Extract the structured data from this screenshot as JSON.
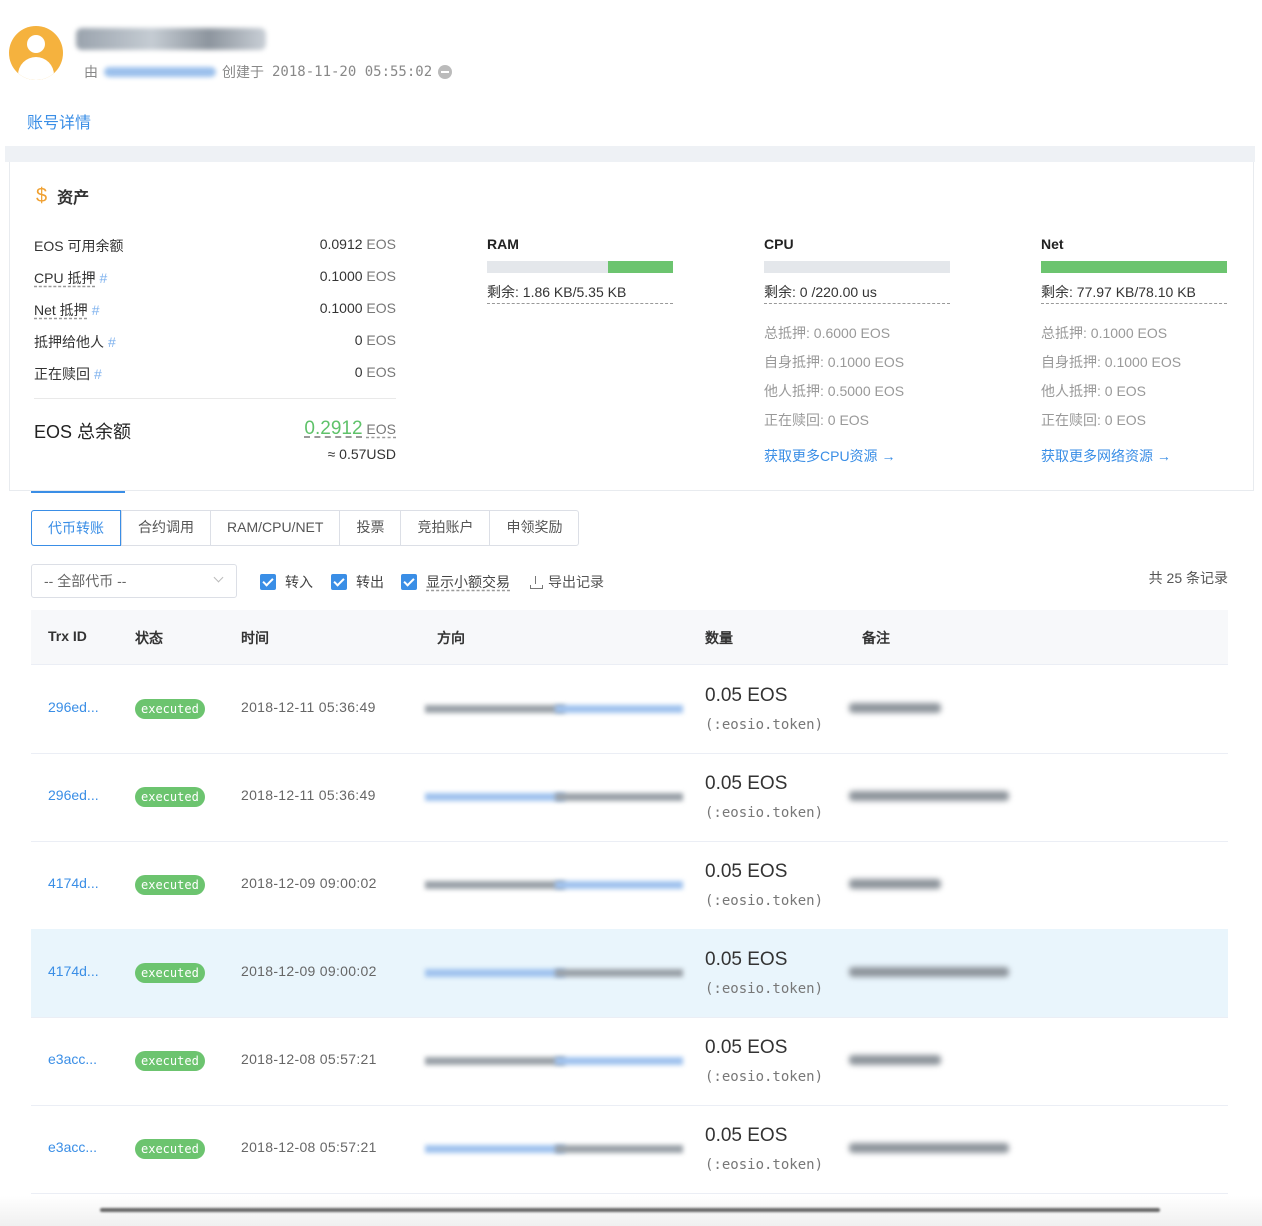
{
  "header": {
    "by_label": "由",
    "created_label": "创建于",
    "created_time": "2018-11-20 05:55:02"
  },
  "main_tab": "账号详情",
  "assets": {
    "title": "资产",
    "rows": [
      {
        "label": "EOS 可用余额",
        "value": "0.0912",
        "unit": "EOS",
        "hash": ""
      },
      {
        "label": "CPU 抵押",
        "value": "0.1000",
        "unit": "EOS",
        "hash": "#"
      },
      {
        "label": "Net 抵押",
        "value": "0.1000",
        "unit": "EOS",
        "hash": "#"
      },
      {
        "label": "抵押给他人",
        "value": "0",
        "unit": "EOS",
        "hash": "#"
      },
      {
        "label": "正在赎回",
        "value": "0",
        "unit": "EOS",
        "hash": "#"
      }
    ],
    "total_label": "EOS 总余额",
    "total_value": "0.2912",
    "total_unit": "EOS",
    "usd": "≈ 0.57USD"
  },
  "resources": {
    "ram": {
      "title": "RAM",
      "remain": "剩余: 1.86 KB/5.35 KB",
      "used_fraction": 0.65
    },
    "cpu": {
      "title": "CPU",
      "remain": "剩余: 0 /220.00 us",
      "used_fraction": 1.0,
      "stats": [
        "总抵押: 0.6000 EOS",
        "自身抵押: 0.1000 EOS",
        "他人抵押: 0.5000 EOS",
        "正在赎回: 0 EOS"
      ],
      "link": "获取更多CPU资源 →"
    },
    "net": {
      "title": "Net",
      "remain": "剩余: 77.97 KB/78.10 KB",
      "used_fraction": 0.0,
      "stats": [
        "总抵押: 0.1000 EOS",
        "自身抵押: 0.1000 EOS",
        "他人抵押: 0 EOS",
        "正在赎回: 0 EOS"
      ],
      "link": "获取更多网络资源 →"
    }
  },
  "sub_tabs": [
    "代币转账",
    "合约调用",
    "RAM/CPU/NET",
    "投票",
    "竞拍账户",
    "申领奖励"
  ],
  "filters": {
    "token_select": "-- 全部代币 --",
    "checkbox_in": "转入",
    "checkbox_out": "转出",
    "checkbox_small": "显示小额交易",
    "export": "导出记录",
    "count": "共 25 条记录"
  },
  "table": {
    "headers": [
      "Trx ID",
      "状态",
      "时间",
      "方向",
      "数量",
      "备注"
    ],
    "rows": [
      {
        "trx": "296ed...",
        "status": "executed",
        "time": "2018-12-11 05:36:49",
        "qty": "0.05 EOS",
        "contract": "(:eosio.token)"
      },
      {
        "trx": "296ed...",
        "status": "executed",
        "time": "2018-12-11 05:36:49",
        "qty": "0.05 EOS",
        "contract": "(:eosio.token)"
      },
      {
        "trx": "4174d...",
        "status": "executed",
        "time": "2018-12-09 09:00:02",
        "qty": "0.05 EOS",
        "contract": "(:eosio.token)"
      },
      {
        "trx": "4174d...",
        "status": "executed",
        "time": "2018-12-09 09:00:02",
        "qty": "0.05 EOS",
        "contract": "(:eosio.token)"
      },
      {
        "trx": "e3acc...",
        "status": "executed",
        "time": "2018-12-08 05:57:21",
        "qty": "0.05 EOS",
        "contract": "(:eosio.token)"
      },
      {
        "trx": "e3acc...",
        "status": "executed",
        "time": "2018-12-08 05:57:21",
        "qty": "0.05 EOS",
        "contract": "(:eosio.token)"
      }
    ]
  },
  "colors": {
    "accent": "#3a8ee6",
    "success": "#6cc46f",
    "highlight_row": "#e9f5fc",
    "avatar": "#f5b23e"
  }
}
